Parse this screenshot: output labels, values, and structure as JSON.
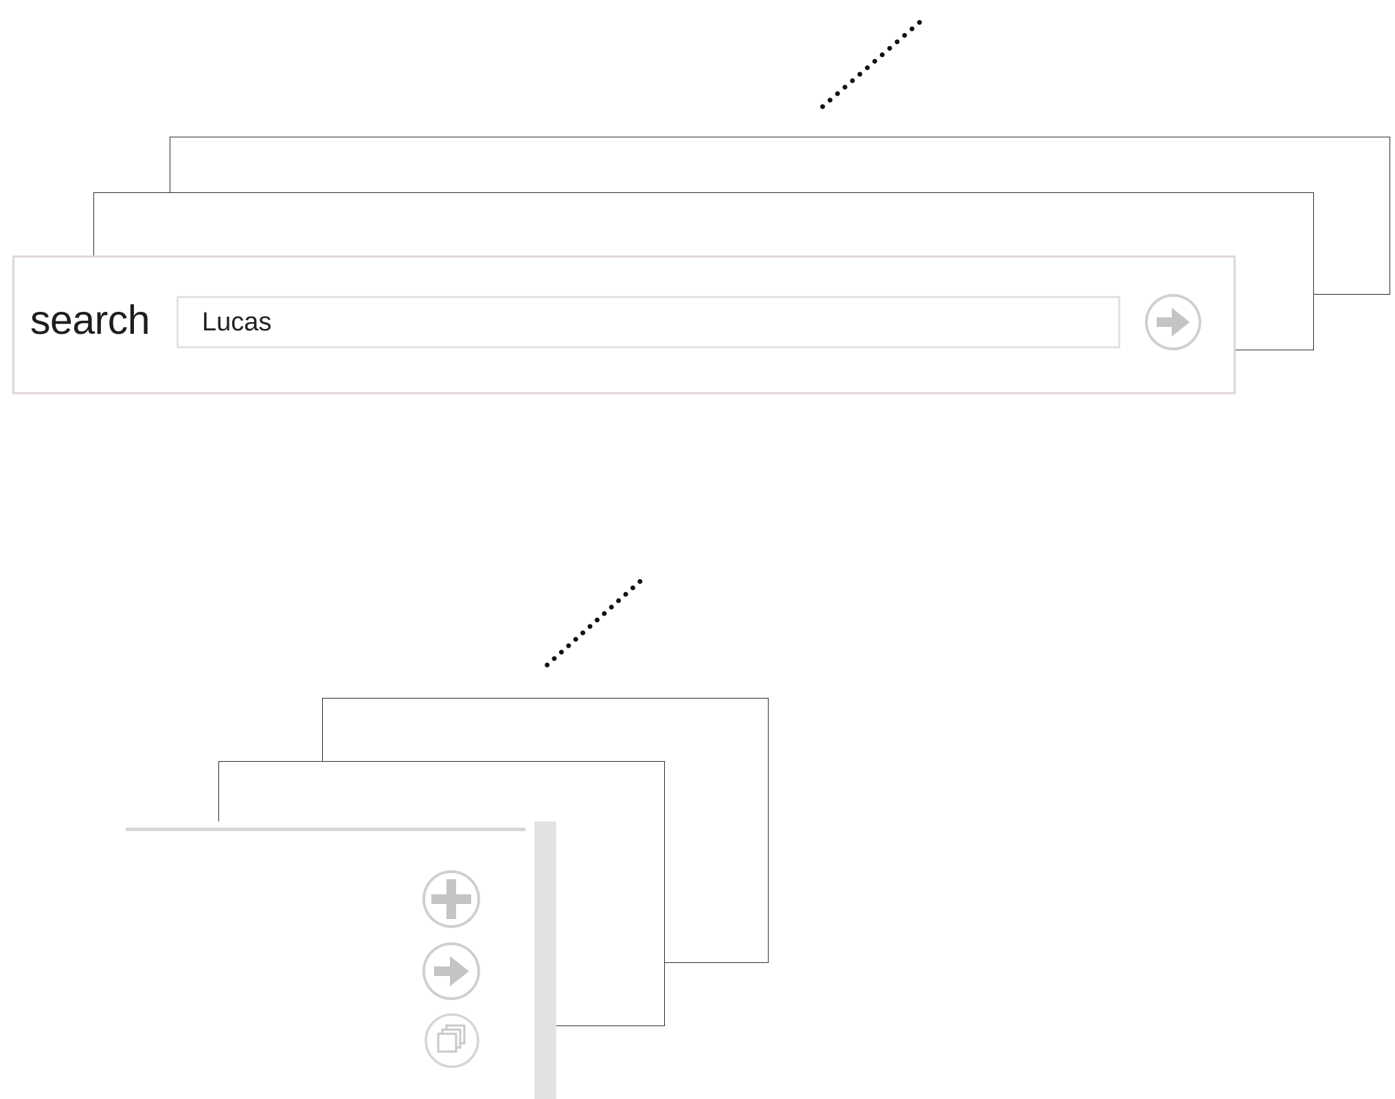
{
  "search": {
    "label": "search",
    "value": "Lucas",
    "go_icon": "arrow-right-circle-icon"
  },
  "toolbar": {
    "buttons": [
      {
        "icon": "plus-circle-icon"
      },
      {
        "icon": "arrow-right-circle-icon"
      },
      {
        "icon": "stacked-windows-circle-icon"
      }
    ]
  },
  "colors": {
    "icon_fill": "#c4c4c4",
    "icon_ring": "#cfcfcf",
    "panel_border": "#e0d6d8",
    "frame_stroke": "#2b2b2b",
    "scrollbar": "#e2e2e2"
  }
}
